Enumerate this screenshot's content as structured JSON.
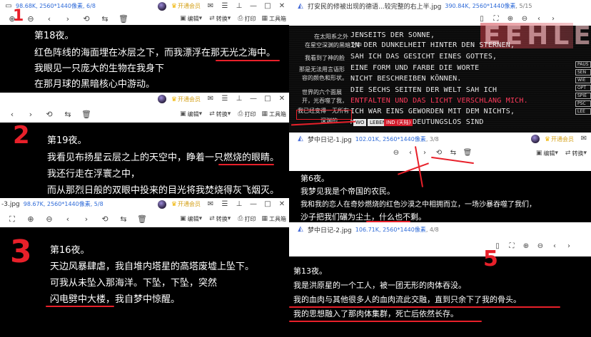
{
  "colors": {
    "annotation": "#e8202a",
    "accent": "#2f6bd8",
    "vip": "#d4a017"
  },
  "panel1": {
    "meta": "98.68K, 2560*1440像素, 6/8",
    "vip": "开通会员",
    "edit": "编辑",
    "convert": "转换",
    "print": "打印",
    "tools": "工具箱",
    "lines": [
      "第18夜。",
      "红色阵线的海面埋在冰层之下，而我漂浮在那无光之海中。",
      "我眼见一只庞大的生物在我身下",
      "在那月球的黑暗核心中游动。"
    ],
    "mark": "1"
  },
  "panel2": {
    "vip": "开通会员",
    "edit": "编辑",
    "convert": "转换",
    "print": "打印",
    "tools": "工具箱",
    "lines": [
      "第19夜。",
      "我看见布扬星云层之上的天空中，睁着一只燃烧的眼睛。",
      "我还行走在浮寰之中，",
      "而从那烈日般的双眼中投来的目光将我焚烧得灰飞烟灭。"
    ],
    "mark": "2"
  },
  "panel3": {
    "fname": "-3.jpg",
    "meta": "98.67K, 2560*1440像素, 5/8",
    "vip": "开通会员",
    "edit": "编辑",
    "convert": "转换",
    "print": "打印",
    "tools": "工具箱",
    "lines": [
      "第16夜。",
      "天边风暴肆虐，我自堆内塔星的高塔废墟上坠下。",
      "可我从未坠入那海洋。下坠，下坠，突然",
      "闪电劈中大楼，我自梦中惊醒。"
    ],
    "mark": "3"
  },
  "panel4": {
    "fname": "打安民的修被出现的德语...较完整的右上半.jpg",
    "meta": "390.84K, 2560*1440像素",
    "page": ", 5/15",
    "german": [
      "JENSEITS DER SONNE,",
      "IN DER DUNKELHEIT HINTER DEN STERNEN,",
      "SAH ICH DAS GESICHT EINES GOTTES,",
      "EINE FORM UND FARBE DIE WORTE",
      "NICHT BESCHREIBEN KÖNNEN.",
      "DIE SECHS SEITEN DER WELT SAH ICH",
      "ENTFALTEN UND DAS LICHT VERSCHLANG MICH.",
      "ICH WAR EINS GEWORDEN MIT DEM NICHTS,",
      "MIT DER TOD BEDEUTUNGSLOS SIND"
    ],
    "side": [
      "在太阳系之外",
      "在星空深渊的黑暗之中",
      "我看到了神的脸",
      "那是无法用言语形",
      "容的颜色和形状。",
      "世界的六个面展",
      "开，光吞噬了我，",
      "我已经变得一无所有",
      "深渊的"
    ],
    "menu": [
      "PAUS",
      "SEN",
      "WIE",
      "OPT",
      "SPIE",
      "PSC",
      "LEE"
    ],
    "buttons": [
      "WO",
      "LEBEN",
      "IND (天陆)"
    ],
    "mark": "4"
  },
  "panel5": {
    "fname": "梦中日记-1.jpg",
    "meta": "102.01K, 2560*1440像素",
    "page": ", 3/8",
    "vip": "开通会员",
    "edit": "编辑",
    "convert": "转换",
    "lines": [
      "第6夜。",
      "我梦见我是个帝国的农民。",
      "我和我的恋人在奇妙燃烧的红色沙漠之中相拥而立，一场沙暴吞噬了我们，",
      "沙子把我们碾为尘土，什么也不剩。"
    ]
  },
  "panel6": {
    "fname": "梦中日记-2.jpg",
    "meta": "106.71K, 2560*1440像素",
    "page": ", 4/8",
    "lines": [
      "第13夜。",
      "我是洪原星的一个工人，被一团无形的肉体吞没。",
      "我的血肉与其他很多人的血肉流此交融，直到只余下了我的骨头。",
      "我的思想融入了那肉体集群，死亡后依然长存。"
    ],
    "mark": "5"
  }
}
